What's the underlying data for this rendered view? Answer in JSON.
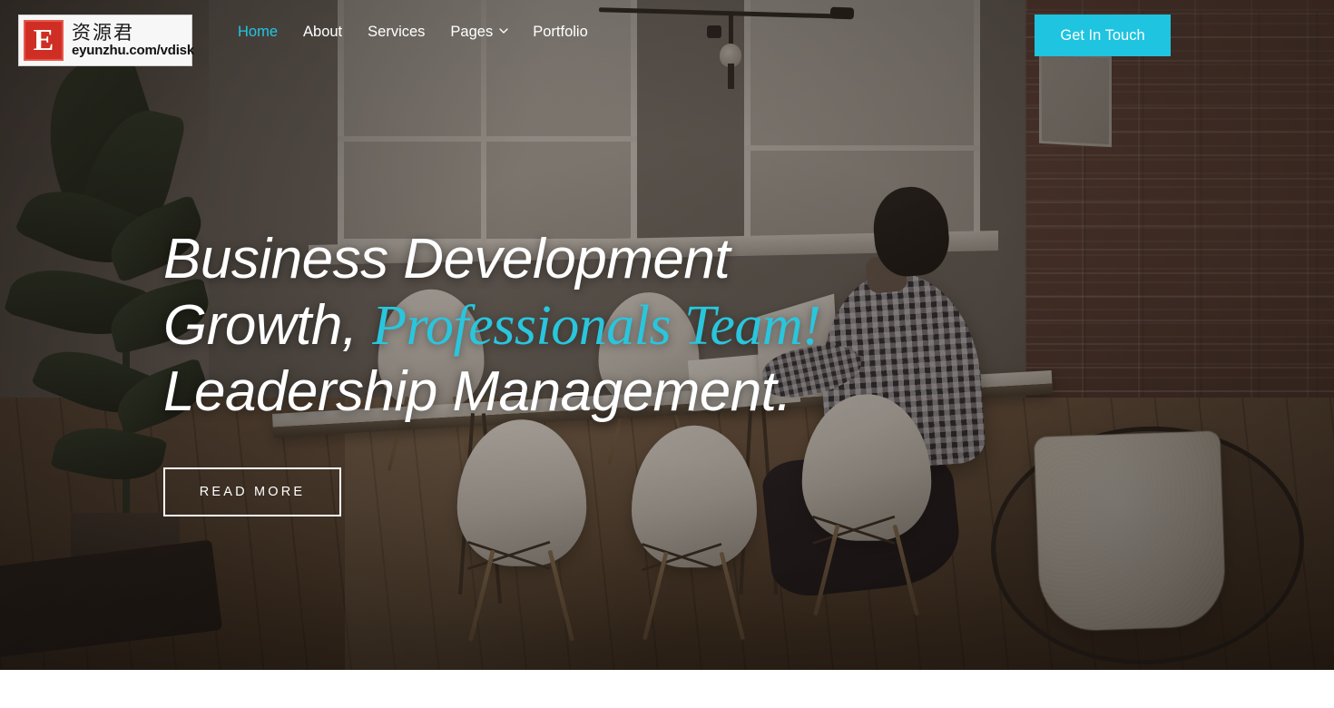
{
  "header": {
    "logo": {
      "mark_letter": "E",
      "chinese_text": "资源君",
      "url_text": "eyunzhu.com/vdisk"
    },
    "nav": [
      {
        "label": "Home",
        "active": true,
        "has_dropdown": false,
        "icon": ""
      },
      {
        "label": "About",
        "active": false,
        "has_dropdown": false,
        "icon": ""
      },
      {
        "label": "Services",
        "active": false,
        "has_dropdown": false,
        "icon": ""
      },
      {
        "label": "Pages",
        "active": false,
        "has_dropdown": true,
        "icon": "chevron-down-icon"
      },
      {
        "label": "Portfolio",
        "active": false,
        "has_dropdown": false,
        "icon": ""
      }
    ],
    "cta_label": "Get In Touch"
  },
  "hero": {
    "headline_line1": "Business Development",
    "headline_line2_plain": "Growth, ",
    "headline_line2_accent": "Professionals Team!",
    "headline_line3": "Leadership Management.",
    "button_label": "READ MORE"
  },
  "colors": {
    "accent_cyan": "#1ec4e0",
    "nav_active": "#1ec8e3",
    "headline_accent": "#29c6dd",
    "logo_red": "#cf2e24",
    "text_white": "#ffffff",
    "page_background": "#ffffff"
  }
}
